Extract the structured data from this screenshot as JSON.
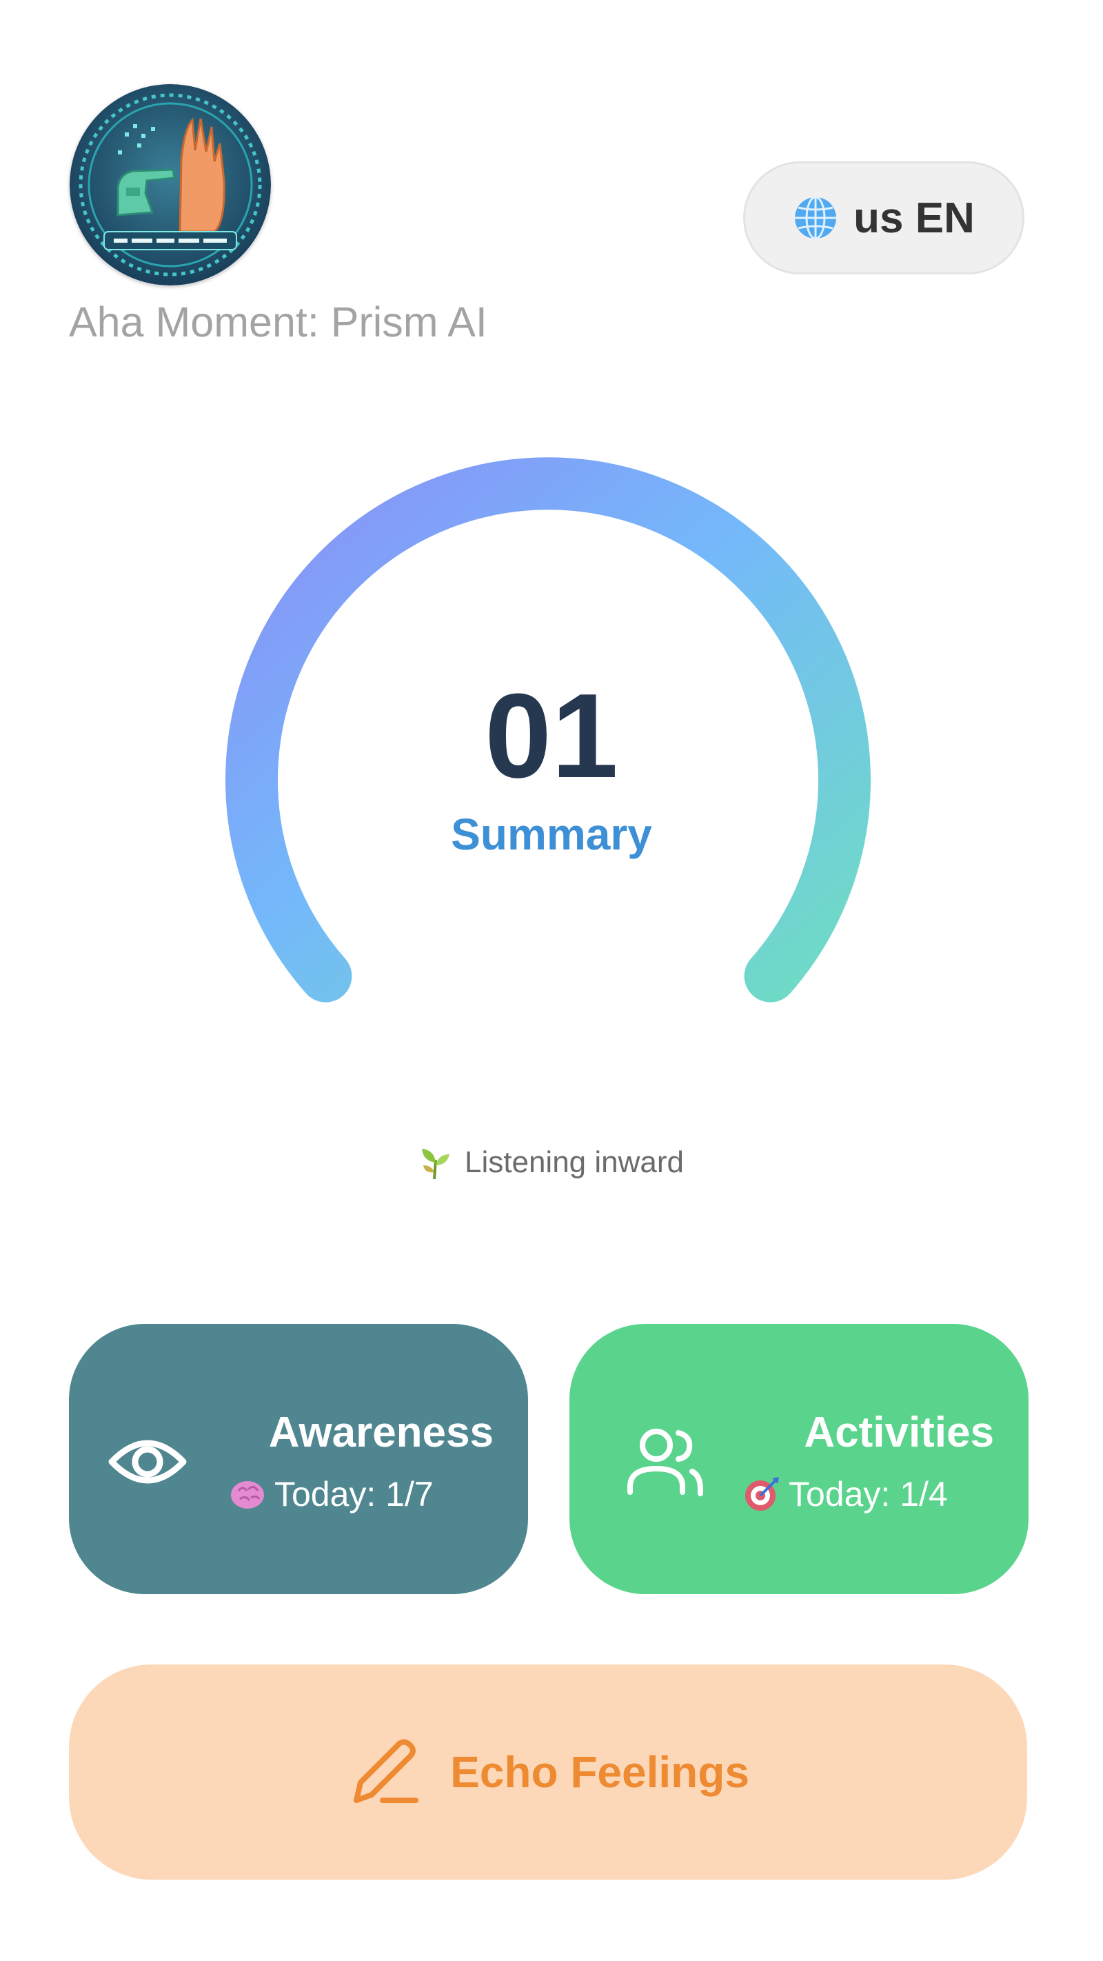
{
  "header": {
    "logo_icon": "robot-and-human-hand-logo-icon",
    "app_title": "Aha Moment: Prism AI",
    "language_button": {
      "icon": "globe-icon",
      "label": "us EN"
    }
  },
  "gauge": {
    "value": "01",
    "label": "Summary",
    "gradient_colors": [
      "#8a8ff5",
      "#74b8fb",
      "#6fdcc4"
    ]
  },
  "status": {
    "icon": "seedling-icon",
    "text": "Listening inward"
  },
  "cards": {
    "awareness": {
      "icon": "eye-icon",
      "title": "Awareness",
      "sub_icon": "brain-icon",
      "sub_text": "Today: 1/7",
      "color": "#4f8690"
    },
    "activities": {
      "icon": "users-icon",
      "title": "Activities",
      "sub_icon": "target-icon",
      "sub_text": "Today: 1/4",
      "color": "#5ad48c"
    }
  },
  "echo_button": {
    "icon": "pen-icon",
    "label": "Echo Feelings",
    "color": "#fdd8b8",
    "text_color": "#ee8a32"
  }
}
